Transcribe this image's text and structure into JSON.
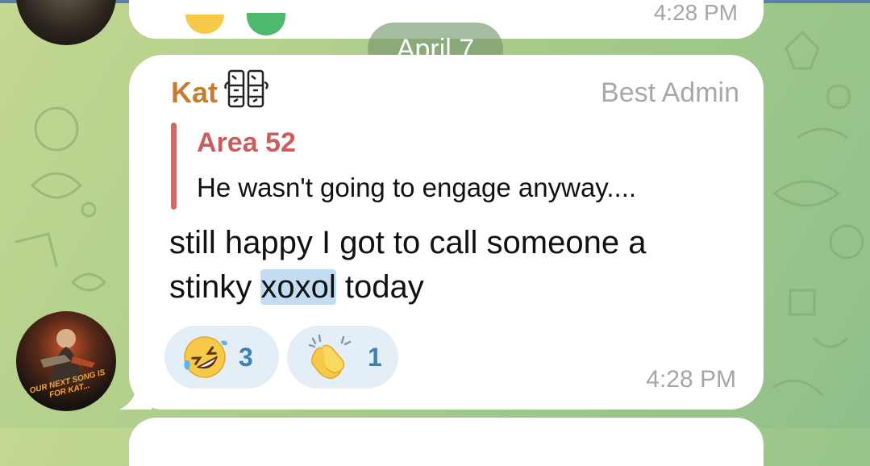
{
  "date_separator": "April 7",
  "previous_message": {
    "time": "4:28 PM"
  },
  "message": {
    "sender": "Kat",
    "sender_role": "Best Admin",
    "reply": {
      "author": "Area 52",
      "text": "He wasn't going to engage anyway...."
    },
    "text_before": "still happy I got to call someone a stinky ",
    "text_highlight": "xoxol",
    "text_after": " today",
    "reactions": [
      {
        "icon": "rolling-on-floor-laughing-icon",
        "count": "3"
      },
      {
        "icon": "clapping-hands-icon",
        "count": "1"
      }
    ],
    "time": "4:28 PM"
  },
  "avatar_caption": "OUR NEXT SONG IS FOR KAT...",
  "colors": {
    "sender": "#c77d2e",
    "reply_bar": "#cd6b6b",
    "reply_author": "#cd5d5d",
    "reaction_count": "#3d7fb8",
    "highlight": "#c4dcf2",
    "bubble": "#ffffff"
  }
}
